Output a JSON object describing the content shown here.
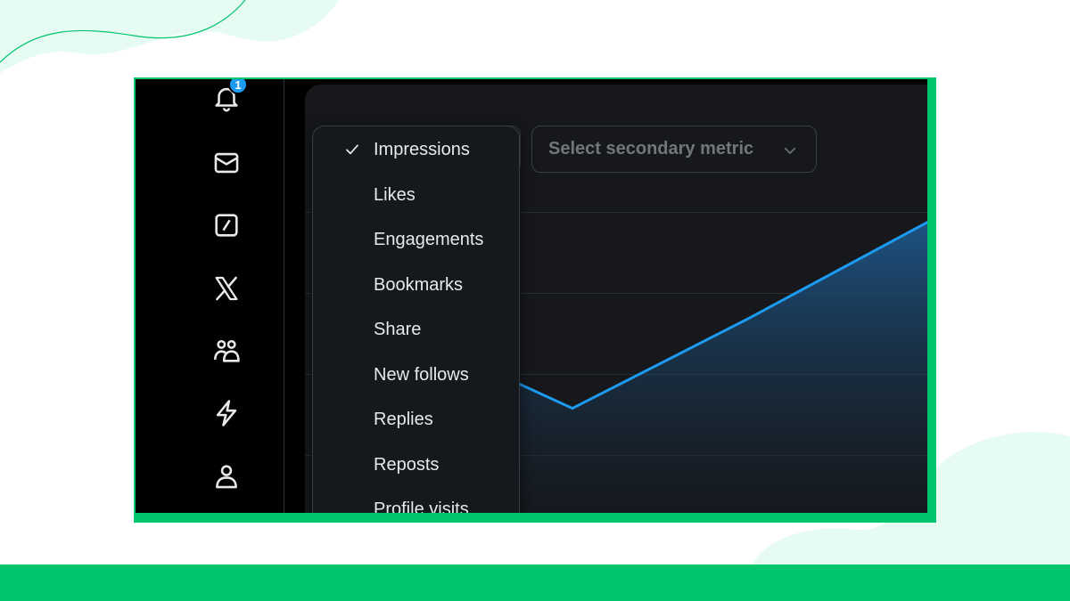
{
  "notifications": {
    "badge_count": "1"
  },
  "nav_icons": [
    "bell-icon",
    "mail-icon",
    "grok-icon",
    "x-logo-icon",
    "communities-icon",
    "lightning-icon",
    "profile-icon"
  ],
  "metric_menu": {
    "selected": "Impressions",
    "items": [
      "Impressions",
      "Likes",
      "Engagements",
      "Bookmarks",
      "Share",
      "New follows",
      "Replies",
      "Reposts",
      "Profile visits"
    ]
  },
  "secondary_metric": {
    "placeholder": "Select secondary metric"
  },
  "colors": {
    "brand_green": "#00c56f",
    "chart_line": "#1d9bf0",
    "panel_bg": "#16181c",
    "badge_blue": "#1d9bf0"
  },
  "chart_data": {
    "type": "area",
    "title": "",
    "xlabel": "",
    "ylabel": "",
    "grid": true,
    "legend": "none",
    "series": [
      {
        "values": [
          0.44,
          0.34,
          0.56,
          0.82
        ]
      }
    ],
    "ylim": [
      0,
      1
    ]
  }
}
